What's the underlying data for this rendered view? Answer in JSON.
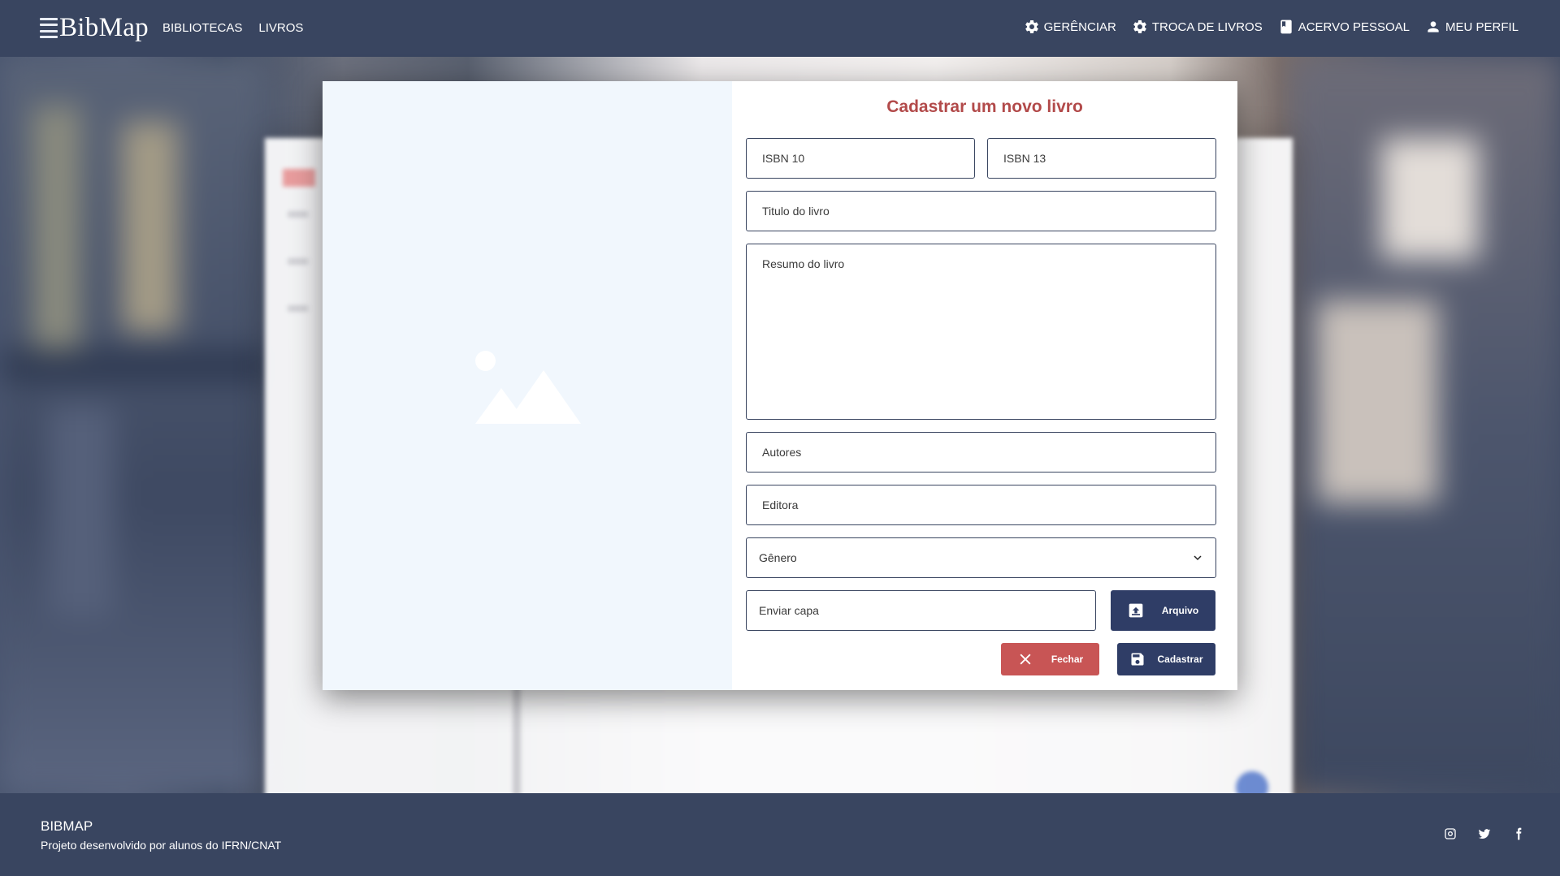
{
  "header": {
    "logo_text": "BibMap",
    "nav_left": [
      "BIBLIOTECAS",
      "LIVROS"
    ],
    "nav_right": [
      {
        "label": "GERÊNCIAR",
        "icon": "gear-icon"
      },
      {
        "label": "TROCA DE LIVROS",
        "icon": "gear-icon"
      },
      {
        "label": "ACERVO PESSOAL",
        "icon": "book-icon"
      },
      {
        "label": "MEU PERFIL",
        "icon": "person-icon"
      }
    ]
  },
  "modal": {
    "title": "Cadastrar um novo livro",
    "image_placeholder_icon": "image-placeholder-icon",
    "isbn10_placeholder": "ISBN 10",
    "isbn13_placeholder": "ISBN 13",
    "title_placeholder": "Titulo do livro",
    "summary_placeholder": "Resumo do livro",
    "authors_placeholder": "Autores",
    "publisher_placeholder": "Editora",
    "genre_selected": "Gênero",
    "cover_placeholder": "Enviar capa",
    "file_button": "Arquivo",
    "close_button": "Fechar",
    "submit_button": "Cadastrar"
  },
  "footer": {
    "title": "BIBMAP",
    "subtitle": "Projeto desenvolvido por alunos do IFRN/CNAT",
    "social_icons": [
      "instagram-icon",
      "twitter-icon",
      "facebook-icon"
    ]
  },
  "colors": {
    "header_bg": "#394560",
    "title_red": "#b24a4a",
    "primary_navy": "#2f3d66",
    "danger_red": "#c85555",
    "image_panel_bg": "#f1f7fd"
  }
}
